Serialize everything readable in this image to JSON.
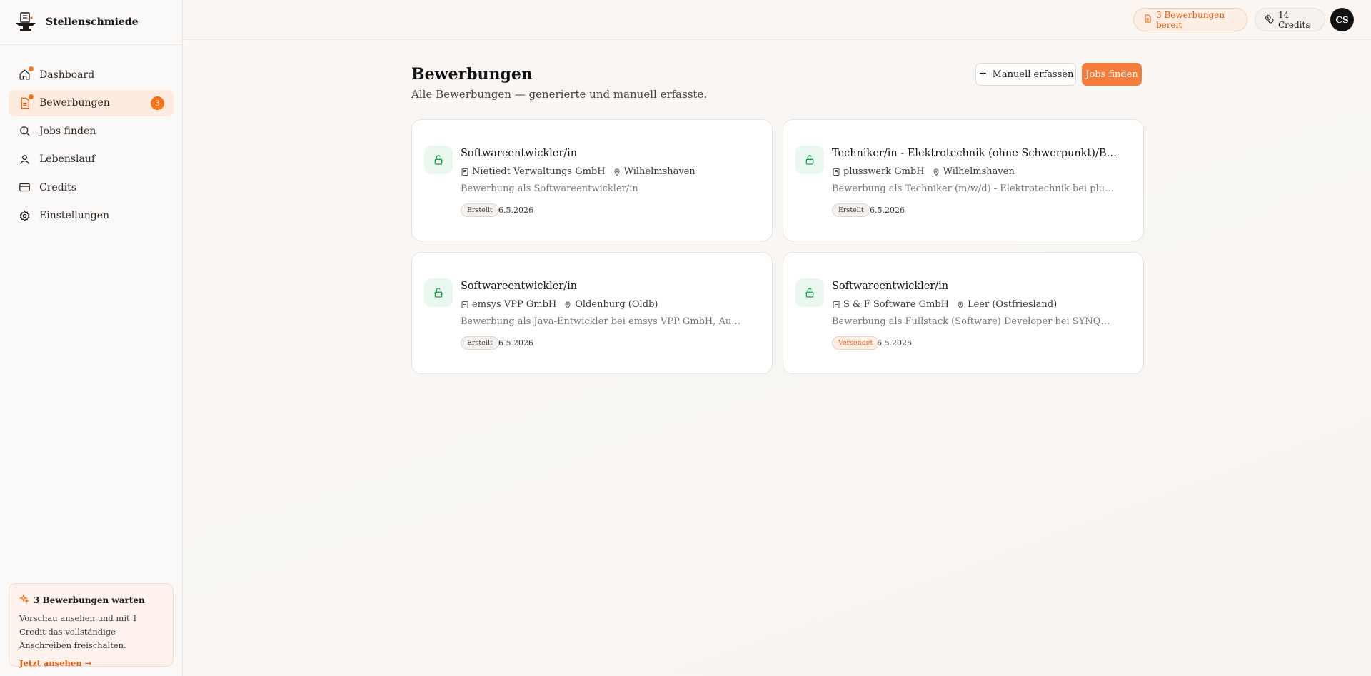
{
  "app": {
    "name": "Stellenschmiede"
  },
  "sidebar": {
    "items": [
      {
        "label": "Dashboard",
        "icon": "home-icon",
        "dot": true
      },
      {
        "label": "Bewerbungen",
        "icon": "document-icon",
        "dot": true,
        "badge": "3",
        "active": true
      },
      {
        "label": "Jobs finden",
        "icon": "search-icon"
      },
      {
        "label": "Lebenslauf",
        "icon": "user-icon"
      },
      {
        "label": "Credits",
        "icon": "credit-card-icon"
      },
      {
        "label": "Einstellungen",
        "icon": "gear-icon"
      }
    ],
    "promo": {
      "title": "3 Bewerbungen warten",
      "text": "Vorschau ansehen und mit 1 Credit das vollständige Anschreiben freischalten.",
      "link": "Jetzt ansehen →"
    }
  },
  "topbar": {
    "ready_pill": "3 Bewerbungen bereit",
    "credits_pill": "14 Credits",
    "avatar_initials": "CS"
  },
  "main": {
    "title": "Bewerbungen",
    "subtitle": "Alle Bewerbungen — generierte und manuell erfasste.",
    "manual_button": "Manuell erfassen",
    "find_button": "Jobs finden",
    "cards": [
      {
        "title": "Softwareentwickler/in",
        "company": "Nietiedt Verwaltungs GmbH",
        "location": "Wilhelmshaven",
        "description": "Bewerbung als Softwareentwickler/in",
        "status": "Erstellt",
        "date": "6.5.2026"
      },
      {
        "title": "Techniker/in - Elektrotechnik (ohne Schwerpunkt)/Bachelor - Elektrotechnik",
        "company": "plusswerk GmbH",
        "location": "Wilhelmshaven",
        "description": "Bewerbung als Techniker (m/w/d) - Elektrotechnik bei plusswerk GmbH",
        "status": "Erstellt",
        "date": "6.5.2026"
      },
      {
        "title": "Softwareentwickler/in",
        "company": "emsys VPP GmbH",
        "location": "Oldenburg (Oldb)",
        "description": "Bewerbung als Java-Entwickler bei emsys VPP GmbH, Ausschreibung",
        "status": "Erstellt",
        "date": "6.5.2026"
      },
      {
        "title": "Softwareentwickler/in",
        "company": "S & F Software GmbH",
        "location": "Leer (Ostfriesland)",
        "description": "Bewerbung als Fullstack (Software) Developer bei SYNQONY, Ausschreibung",
        "status": "Versendet",
        "date": "6.5.2026"
      }
    ]
  },
  "colors": {
    "accent": "#f97316",
    "success_bg": "#eaf7ee",
    "success": "#16a34a"
  }
}
